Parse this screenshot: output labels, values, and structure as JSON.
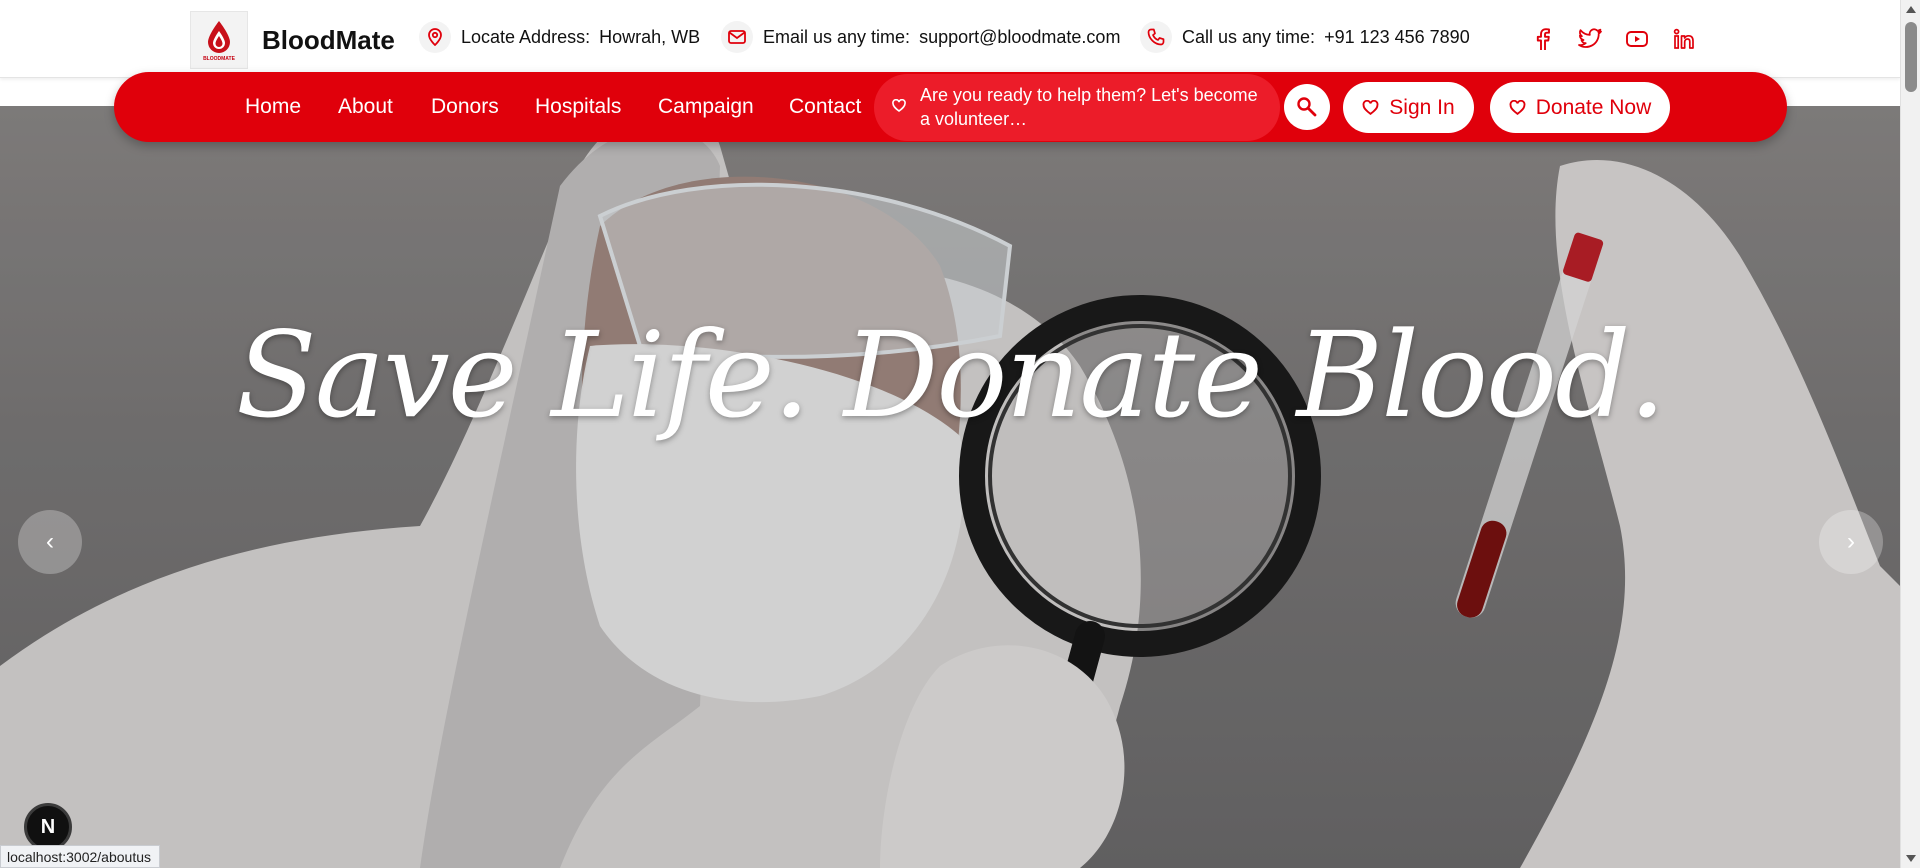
{
  "brand": {
    "name": "BloodMate",
    "logo_mini_text": "BLOODMATE",
    "logo_icon": "blood-drop-logo"
  },
  "contact": [
    {
      "icon": "location-pin-icon",
      "label": "Locate Address:",
      "value": "Howrah, WB"
    },
    {
      "icon": "mail-icon",
      "label": "Email us any time:",
      "value": "support@bloodmate.com"
    },
    {
      "icon": "phone-icon",
      "label": "Call us any time:",
      "value": "+91 123 456 7890"
    }
  ],
  "socials": [
    "facebook-icon",
    "twitter-icon",
    "youtube-icon",
    "linkedin-icon"
  ],
  "nav": {
    "items": [
      "Home",
      "About",
      "Donors",
      "Hospitals",
      "Campaign",
      "Contact"
    ],
    "cta_text": "Are you ready to help them? Let's become a volunteer…",
    "sign_in": "Sign In",
    "donate": "Donate Now"
  },
  "hero": {
    "title": "Save Life. Donate Blood.",
    "subtitle": "",
    "prev": "‹",
    "next": "›"
  },
  "overlay": {
    "badge": "N",
    "status_url": "localhost:3002/aboutus"
  },
  "colors": {
    "accent": "#e0000b",
    "pill": "#ec1c29",
    "text": "#111111"
  }
}
